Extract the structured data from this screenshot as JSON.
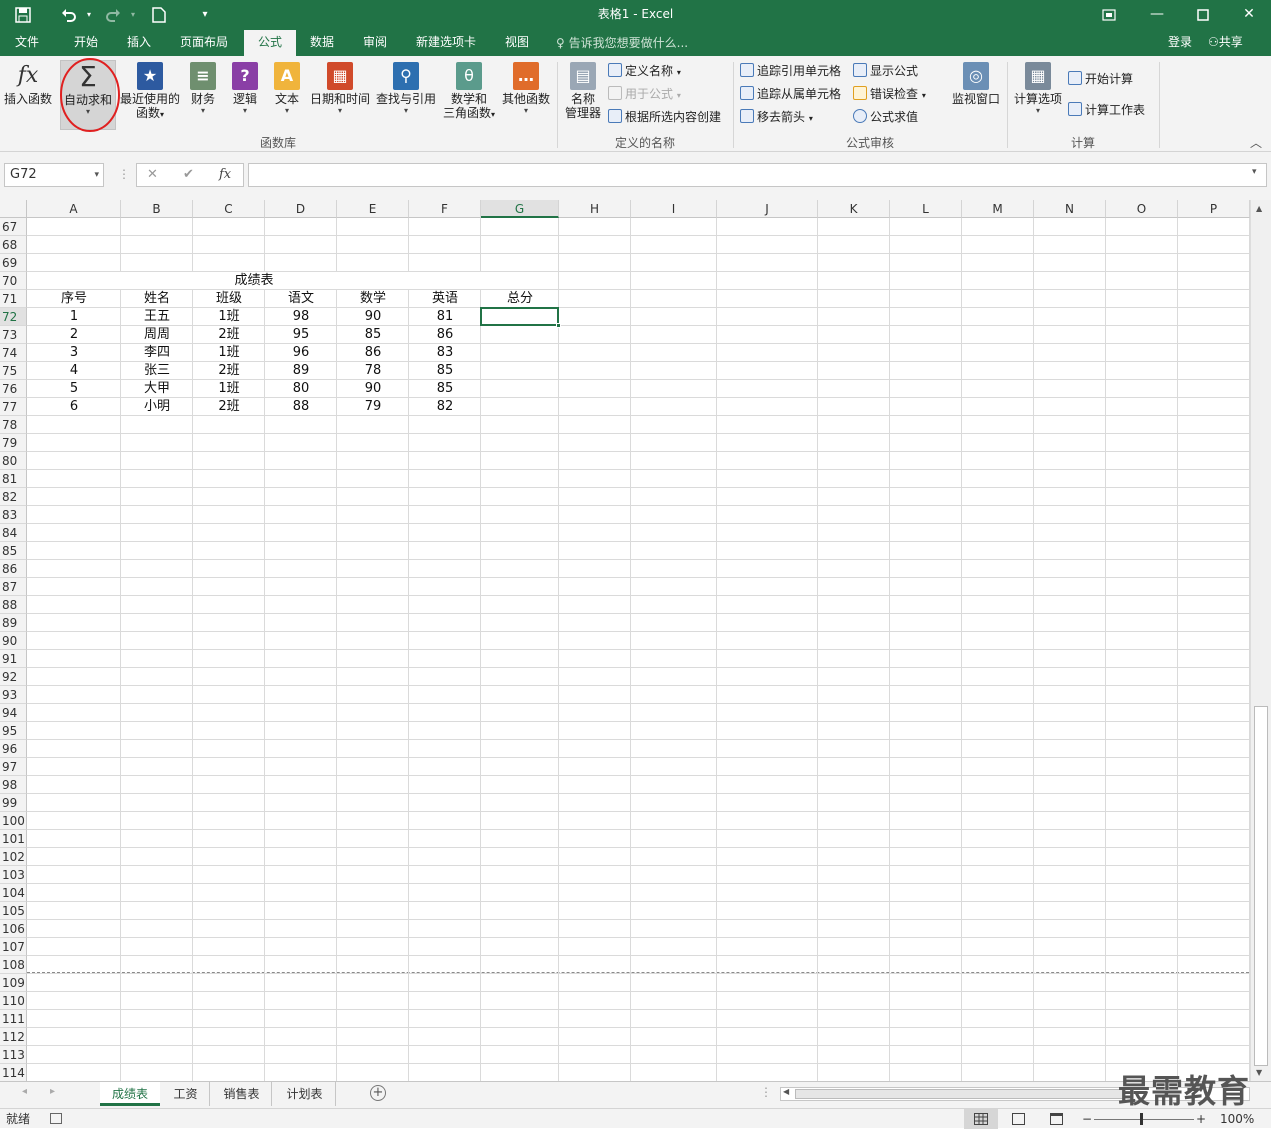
{
  "titlebar": {
    "title": "表格1 - Excel",
    "save_icon": "save-icon",
    "undo_icon": "undo-icon",
    "redo_icon": "redo-icon",
    "new_icon": "new-file-icon",
    "customize_icon": "customize-qat-icon",
    "restore_icon": "restore-icon",
    "minimize_icon": "minimize-icon",
    "maximize_icon": "maximize-icon",
    "close_icon": "close-icon"
  },
  "tabs": [
    "文件",
    "开始",
    "插入",
    "页面布局",
    "公式",
    "数据",
    "审阅",
    "新建选项卡",
    "视图"
  ],
  "active_tab": "公式",
  "tellme": "告诉我您想要做什么...",
  "signin": "登录",
  "share": "共享",
  "ribbon": {
    "function_library": {
      "label": "函数库",
      "insert_function": "插入函数",
      "autosum": "自动求和",
      "recent_1": "最近使用的",
      "recent_2": "函数",
      "financial": "财务",
      "logical": "逻辑",
      "text": "文本",
      "datetime": "日期和时间",
      "lookup": "查找与引用",
      "math_1": "数学和",
      "math_2": "三角函数",
      "more": "其他函数"
    },
    "defined_names": {
      "label": "定义的名称",
      "manager_1": "名称",
      "manager_2": "管理器",
      "define": "定义名称",
      "use_in": "用于公式",
      "create": "根据所选内容创建"
    },
    "auditing": {
      "label": "公式审核",
      "trace_precedents": "追踪引用单元格",
      "trace_dependents": "追踪从属单元格",
      "remove_arrows": "移去箭头",
      "show_formulas": "显示公式",
      "error_check": "错误检查",
      "evaluate": "公式求值",
      "watch": "监视窗口"
    },
    "calculation": {
      "label": "计算",
      "options": "计算选项",
      "calc_now": "开始计算",
      "calc_sheet": "计算工作表"
    }
  },
  "formula_bar": {
    "namebox": "G72",
    "cancel": "✕",
    "enter": "✔",
    "fx": "fx",
    "content": ""
  },
  "columns": [
    "A",
    "B",
    "C",
    "D",
    "E",
    "F",
    "G",
    "H",
    "I",
    "J",
    "K",
    "L",
    "M",
    "N",
    "O",
    "P"
  ],
  "rows": [
    "67",
    "68",
    "69",
    "70",
    "71",
    "72",
    "73",
    "74",
    "75",
    "76",
    "77",
    "78",
    "79",
    "80",
    "81",
    "82",
    "83",
    "84",
    "85",
    "86",
    "87",
    "88",
    "89",
    "90",
    "91",
    "92",
    "93",
    "94",
    "95",
    "96",
    "97",
    "98",
    "99",
    "100",
    "101",
    "102",
    "103",
    "104",
    "105",
    "106",
    "107",
    "108",
    "109",
    "110",
    "111",
    "112",
    "113",
    "114"
  ],
  "sheet": {
    "title": "成绩表",
    "headers": [
      "序号",
      "姓名",
      "班级",
      "语文",
      "数学",
      "英语",
      "总分"
    ],
    "records": [
      [
        "1",
        "王五",
        "1班",
        "98",
        "90",
        "81"
      ],
      [
        "2",
        "周周",
        "2班",
        "95",
        "85",
        "86"
      ],
      [
        "3",
        "李四",
        "1班",
        "96",
        "86",
        "83"
      ],
      [
        "4",
        "张三",
        "2班",
        "89",
        "78",
        "85"
      ],
      [
        "5",
        "大甲",
        "1班",
        "80",
        "90",
        "85"
      ],
      [
        "6",
        "小明",
        "2班",
        "88",
        "79",
        "82"
      ]
    ]
  },
  "sheet_tabs": [
    "成绩表",
    "工资",
    "销售表",
    "计划表"
  ],
  "active_sheet": "成绩表",
  "status": {
    "ready": "就绪",
    "zoom": "100%",
    "zoom_out": "−",
    "zoom_in": "+"
  },
  "watermark": "最需教育"
}
